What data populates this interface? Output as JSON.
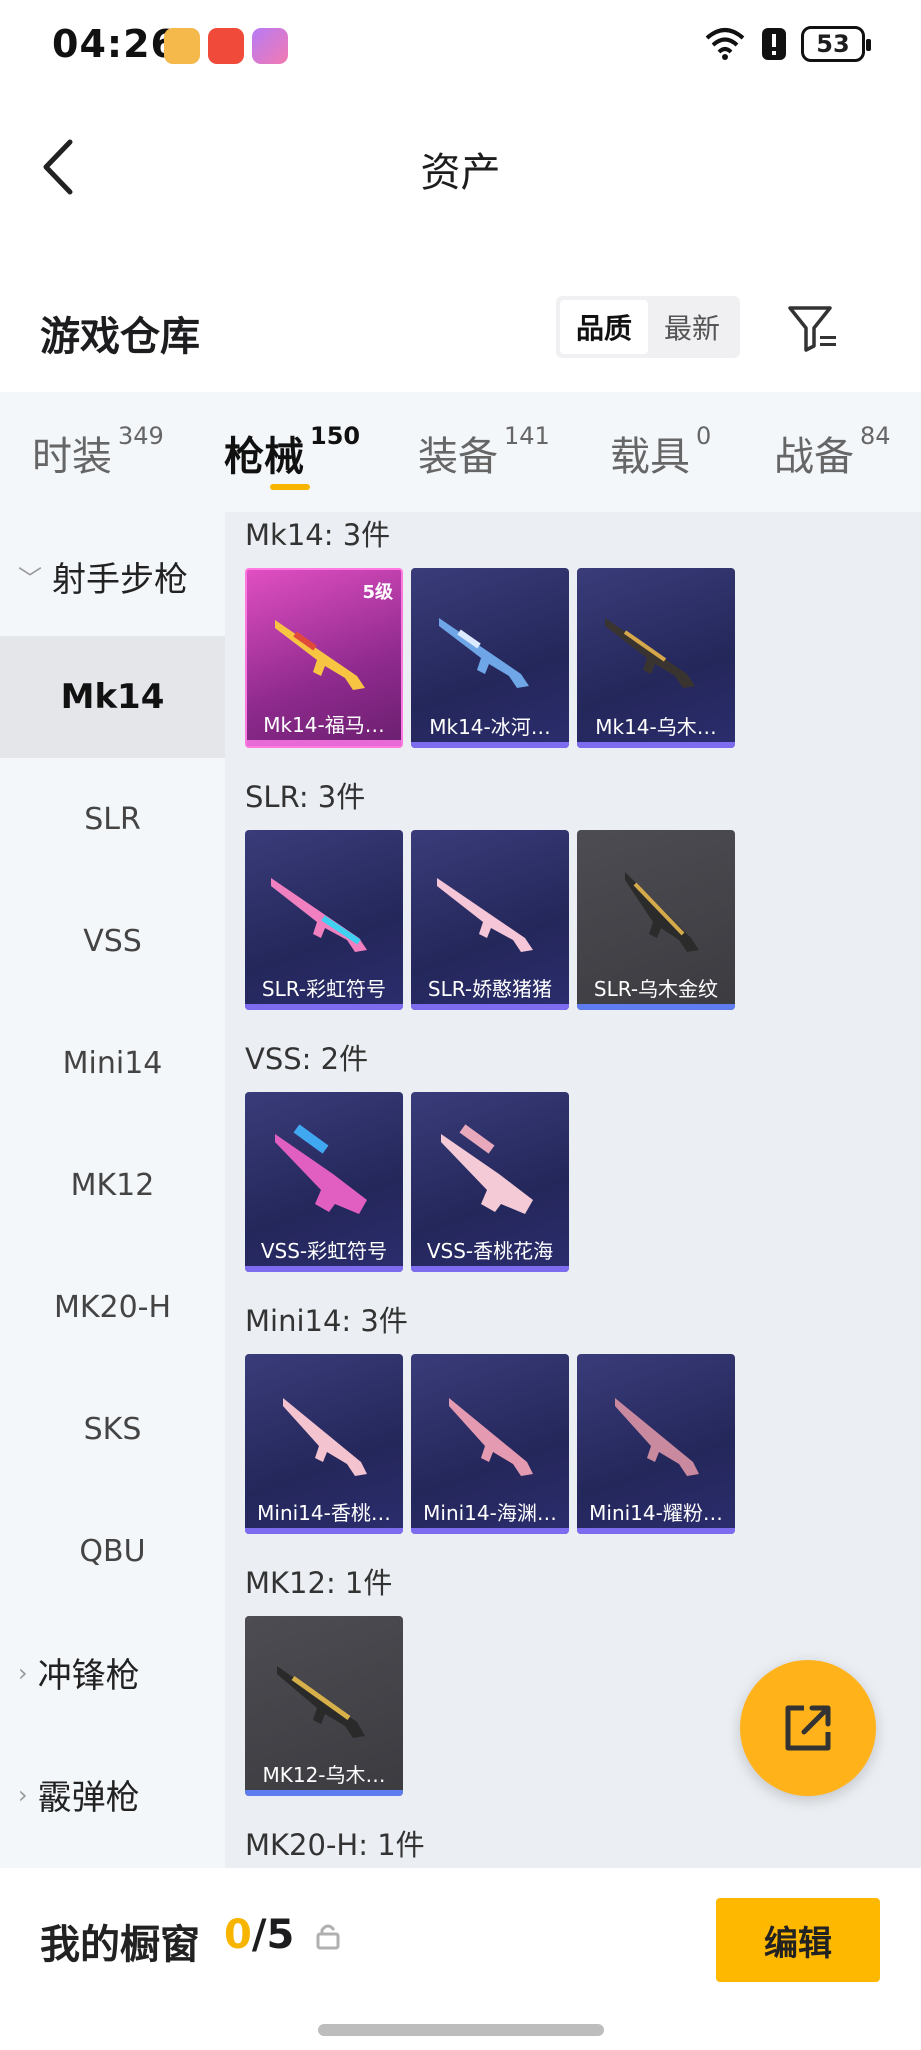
{
  "status": {
    "time": "04:26",
    "battery": "53"
  },
  "nav": {
    "title": "资产"
  },
  "warehouse": {
    "title": "游戏仓库",
    "sort_options": [
      "品质",
      "最新"
    ]
  },
  "tabs": [
    {
      "label": "时装",
      "count": "349"
    },
    {
      "label": "枪械",
      "count": "150"
    },
    {
      "label": "装备",
      "count": "141"
    },
    {
      "label": "载具",
      "count": "0"
    },
    {
      "label": "战备",
      "count": "84"
    }
  ],
  "sidebar": {
    "group_rifles": "射手步枪",
    "items": [
      "Mk14",
      "SLR",
      "VSS",
      "Mini14",
      "MK12",
      "MK20-H",
      "SKS",
      "QBU"
    ],
    "group_smg": "冲锋枪",
    "group_shotgun": "霰弹枪"
  },
  "sections": [
    {
      "label": "Mk14: 3件",
      "cards": [
        {
          "name": "Mk14-福马…",
          "level": "5级"
        },
        {
          "name": "Mk14-冰河…"
        },
        {
          "name": "Mk14-乌木…"
        }
      ]
    },
    {
      "label": "SLR: 3件",
      "cards": [
        {
          "name": "SLR-彩虹符号"
        },
        {
          "name": "SLR-娇憨猪猪"
        },
        {
          "name": "SLR-乌木金纹"
        }
      ]
    },
    {
      "label": "VSS: 2件",
      "cards": [
        {
          "name": "VSS-彩虹符号"
        },
        {
          "name": "VSS-香桃花海"
        }
      ]
    },
    {
      "label": "Mini14: 3件",
      "cards": [
        {
          "name": "Mini14-香桃…"
        },
        {
          "name": "Mini14-海渊…"
        },
        {
          "name": "Mini14-耀粉…"
        }
      ]
    },
    {
      "label": "MK12: 1件",
      "cards": [
        {
          "name": "MK12-乌木…"
        }
      ]
    },
    {
      "label": "MK20-H: 1件",
      "cards": []
    }
  ],
  "showcase": {
    "label": "我的橱窗",
    "current": "0",
    "total": "/5",
    "edit_label": "编辑"
  },
  "colors": {
    "accent": "#f7b500",
    "fab": "#ffb21a"
  }
}
